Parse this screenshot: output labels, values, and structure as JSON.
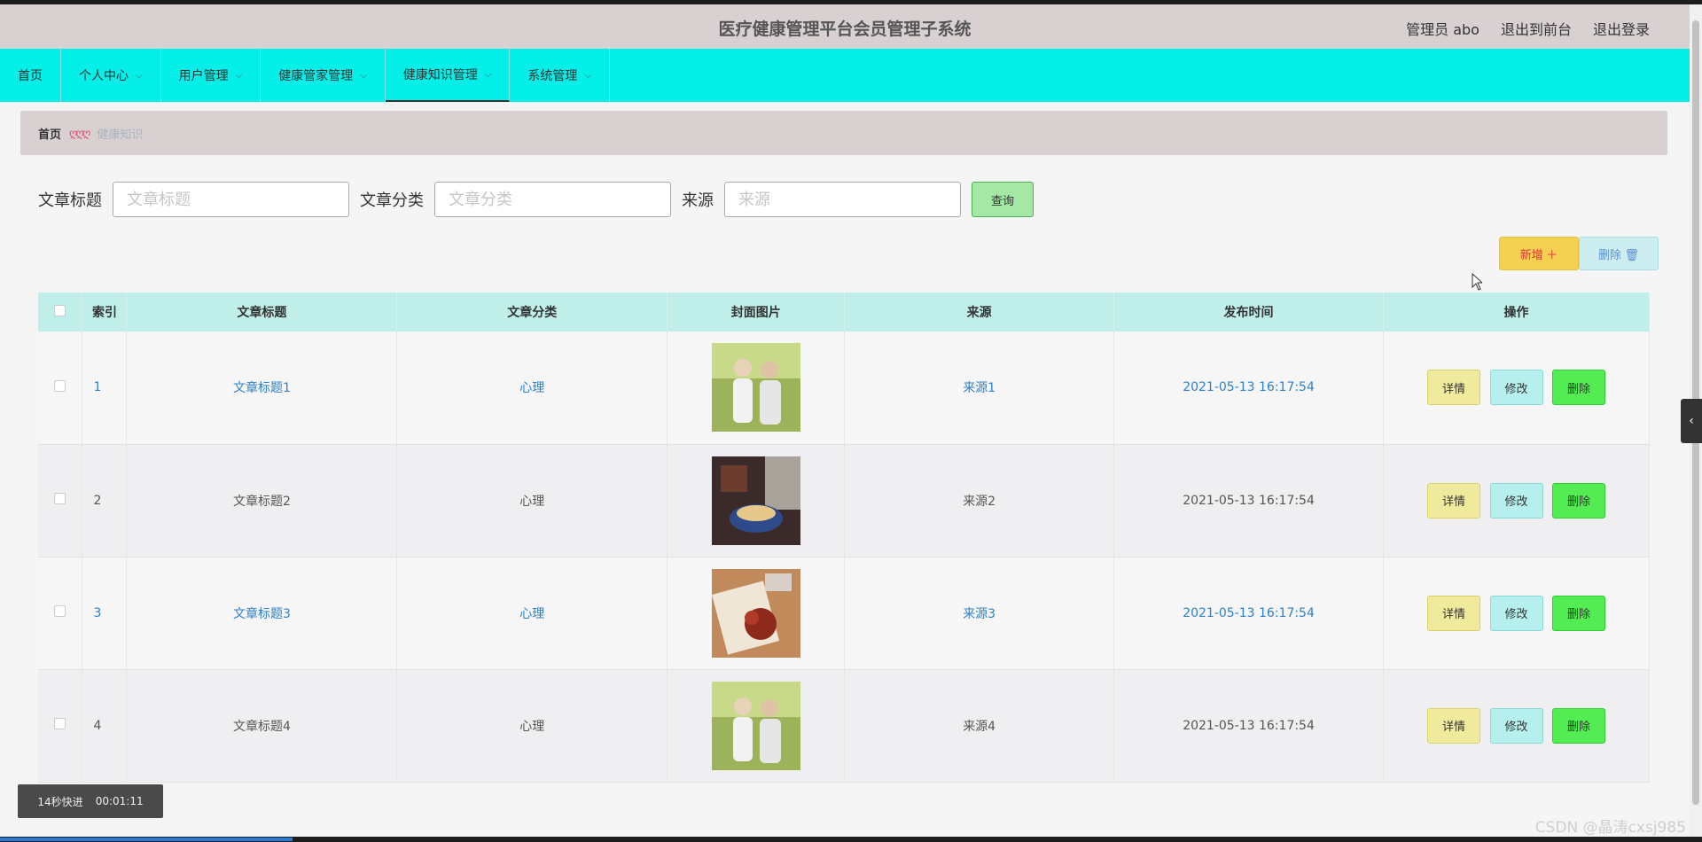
{
  "header": {
    "title": "医疗健康管理平台会员管理子系统",
    "admin": "管理员 abo",
    "to_front": "退出到前台",
    "logout": "退出登录"
  },
  "nav": {
    "items": [
      {
        "label": "首页",
        "has_dropdown": false
      },
      {
        "label": "个人中心",
        "has_dropdown": true
      },
      {
        "label": "用户管理",
        "has_dropdown": true
      },
      {
        "label": "健康管家管理",
        "has_dropdown": true
      },
      {
        "label": "健康知识管理",
        "has_dropdown": true,
        "active": true
      },
      {
        "label": "系统管理",
        "has_dropdown": true
      }
    ]
  },
  "breadcrumb": {
    "home": "首页",
    "separator": "ღღღ",
    "current": "健康知识"
  },
  "search": {
    "title_label": "文章标题",
    "title_placeholder": "文章标题",
    "category_label": "文章分类",
    "category_placeholder": "文章分类",
    "source_label": "来源",
    "source_placeholder": "来源",
    "query_button": "查询"
  },
  "actions": {
    "add_label": "新增 ＋",
    "delete_label": "删除 🗑"
  },
  "table": {
    "headers": {
      "index": "索引",
      "title": "文章标题",
      "category": "文章分类",
      "cover": "封面图片",
      "source": "来源",
      "published": "发布时间",
      "ops": "操作"
    },
    "rows": [
      {
        "index": "1",
        "title": "文章标题1",
        "category": "心理",
        "cover": "elderly-couple",
        "source": "来源1",
        "published": "2021-05-13 16:17:54"
      },
      {
        "index": "2",
        "title": "文章标题2",
        "category": "心理",
        "cover": "cooking-scene",
        "source": "来源2",
        "published": "2021-05-13 16:17:54"
      },
      {
        "index": "3",
        "title": "文章标题3",
        "category": "心理",
        "cover": "food-plate",
        "source": "来源3",
        "published": "2021-05-13 16:17:54"
      },
      {
        "index": "4",
        "title": "文章标题4",
        "category": "心理",
        "cover": "elderly-couple",
        "source": "来源4",
        "published": "2021-05-13 16:17:54"
      }
    ],
    "row_ops": {
      "detail": "详情",
      "edit": "修改",
      "delete": "删除"
    }
  },
  "overlay": {
    "speed_label": "14秒快进",
    "time": "00:01:11",
    "watermark": "CSDN @晶涛cxsj985"
  },
  "colors": {
    "nav_bg": "#05efe9",
    "header_bg": "#d9d1d1",
    "table_header_bg": "#c0eee9",
    "link": "#2f80c8"
  }
}
